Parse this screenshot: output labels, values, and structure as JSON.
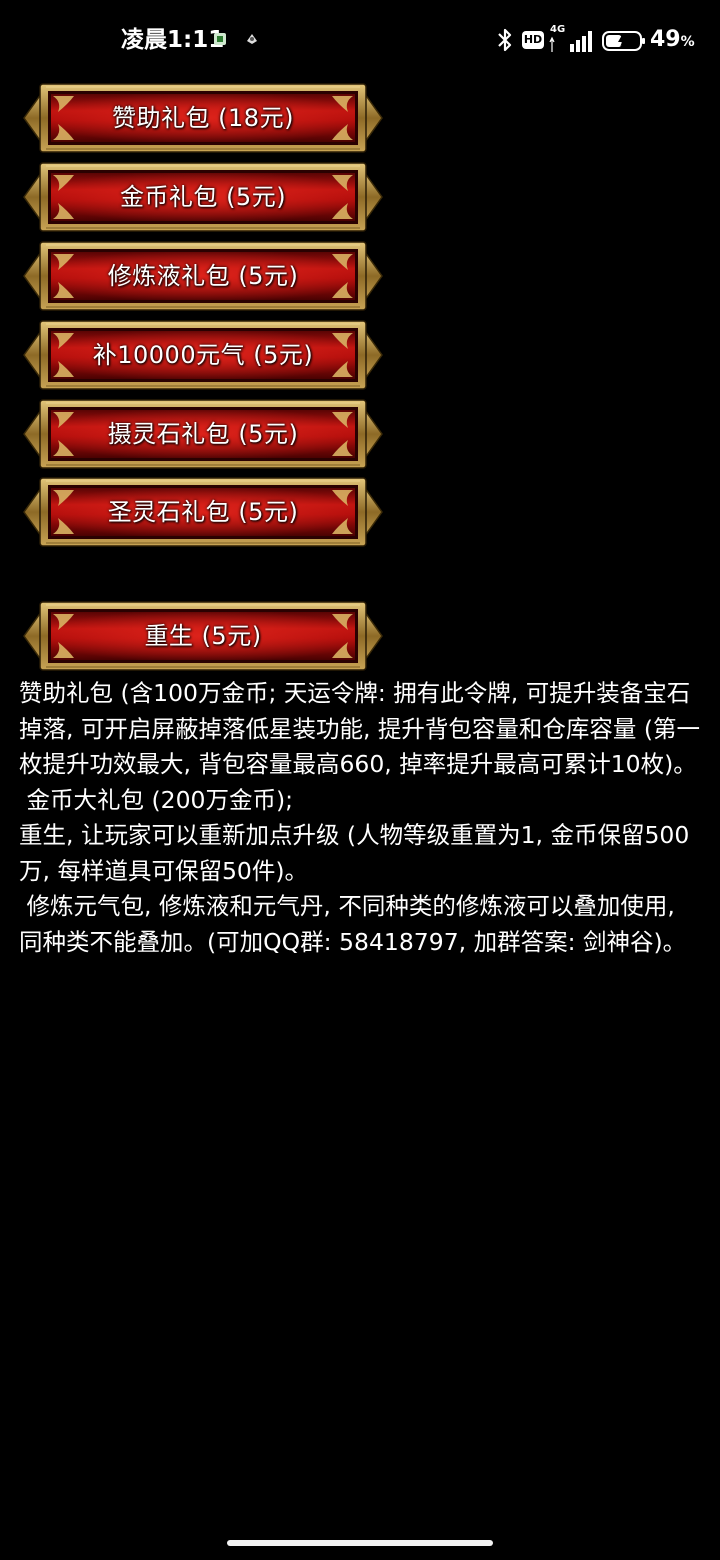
{
  "status_bar": {
    "time": "凌晨1:11",
    "network_type": "4G",
    "hd_label": "HD",
    "battery_percent": "49",
    "battery_percent_symbol": "%",
    "battery_level": 0.49,
    "icons": [
      "notification-icon",
      "notification-icon",
      "bluetooth-icon",
      "hd-icon",
      "signal-icon",
      "battery-icon"
    ]
  },
  "menu": {
    "items": [
      {
        "label": "赞助礼包 (18元)"
      },
      {
        "label": "金币礼包 (5元)"
      },
      {
        "label": "修炼液礼包 (5元)"
      },
      {
        "label": "补10000元气 (5元)"
      },
      {
        "label": "摄灵石礼包 (5元)"
      },
      {
        "label": "圣灵石礼包 (5元)"
      },
      {
        "label": "重生 (5元)"
      }
    ]
  },
  "description": {
    "paragraphs": [
      "赞助礼包 (含100万金币; 天运令牌: 拥有此令牌, 可提升装备宝石掉落, 可开启屏蔽掉落低星装功能, 提升背包容量和仓库容量 (第一枚提升功效最大, 背包容量最高660, 掉率提升最高可累计10枚)。",
      " 金币大礼包 (200万金币);",
      "重生, 让玩家可以重新加点升级 (人物等级重置为1, 金币保留500万, 每样道具可保留50件)。",
      " 修炼元气包, 修炼液和元气丹, 不同种类的修炼液可以叠加使用, 同种类不能叠加。(可加QQ群: 58418797, 加群答案: 剑神谷)。"
    ]
  },
  "colors": {
    "background": "#000000",
    "button_red": "#b3100e",
    "button_gold": "#b08a3a",
    "text": "#ffffff"
  }
}
